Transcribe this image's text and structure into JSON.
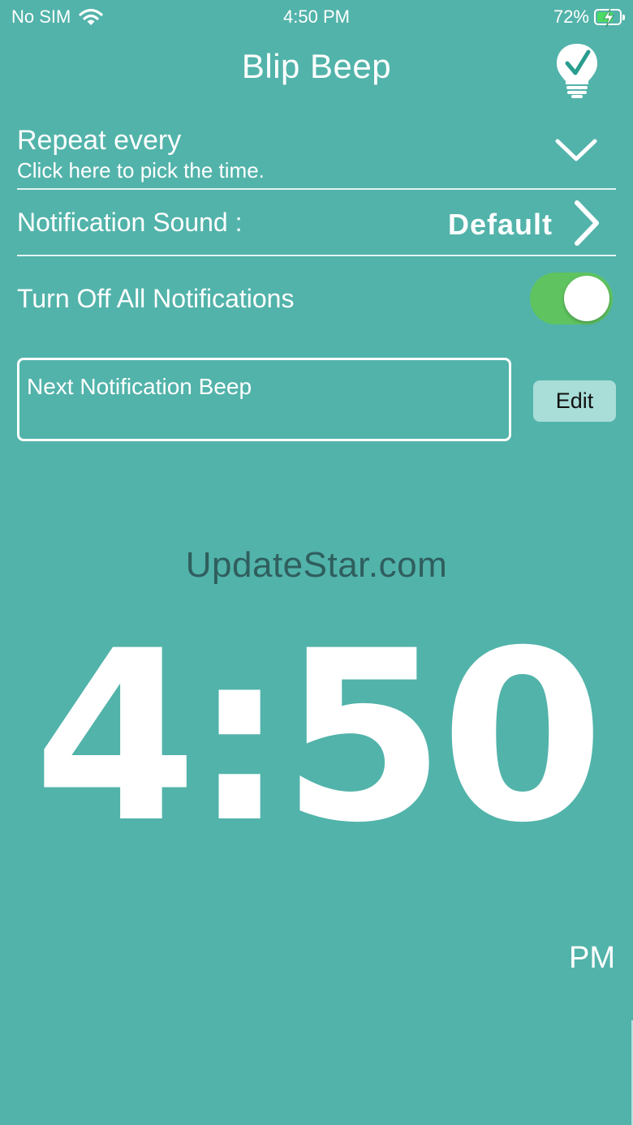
{
  "status_bar": {
    "carrier": "No SIM",
    "time": "4:50 PM",
    "battery_percent": "72%",
    "battery_level": 0.72,
    "battery_fill_color": "#4cd964",
    "icons": [
      "wifi-icon",
      "battery-icon",
      "charging-bolt-icon"
    ]
  },
  "nav": {
    "title": "Blip Beep",
    "right_icon": "lightbulb-check-icon"
  },
  "settings": {
    "repeat": {
      "title": "Repeat every",
      "subtitle": "Click here to pick the time.",
      "icon": "chevron-down-icon"
    },
    "sound": {
      "label": "Notification Sound :",
      "value": "Default",
      "icon": "chevron-right-icon"
    },
    "turn_off": {
      "label": "Turn Off All Notifications",
      "on": true,
      "on_color": "#5fc45f"
    }
  },
  "next_notification": {
    "label": "Next Notification Beep",
    "edit_label": "Edit"
  },
  "watermark": "UpdateStar.com",
  "clock": {
    "time": "4:50",
    "ampm": "PM"
  },
  "colors": {
    "background": "#52b3aa",
    "edit_button": "#a9ddd8",
    "watermark": "#2f5e5e"
  }
}
